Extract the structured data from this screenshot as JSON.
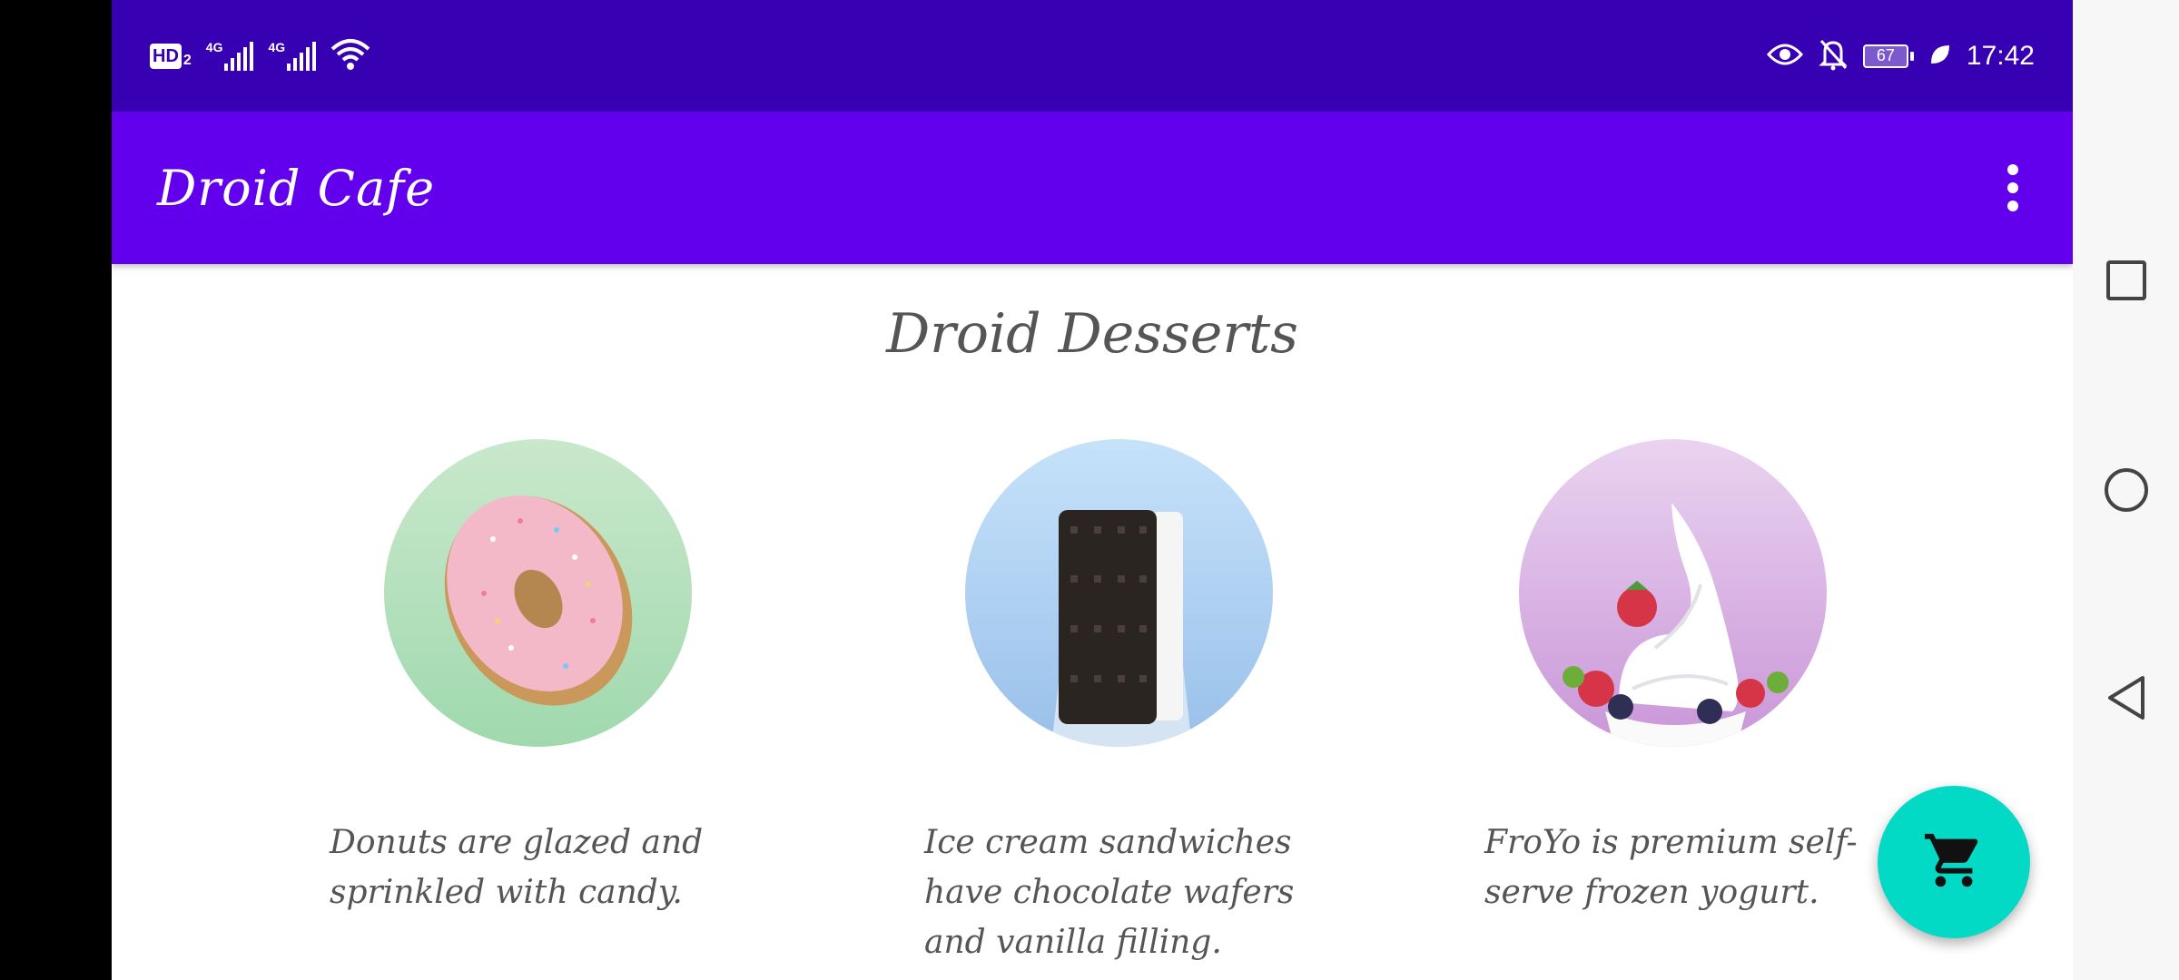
{
  "status_bar": {
    "hd_label": "HD",
    "hd_sub": "2",
    "network_1": "4G",
    "network_2": "4G",
    "battery": "67",
    "time": "17:42"
  },
  "app_bar": {
    "title": "Droid Cafe",
    "overflow_icon": "more-vert-icon"
  },
  "main": {
    "heading": "Droid Desserts",
    "desserts": [
      {
        "image": "donut-image",
        "description": "Donuts are glazed and sprinkled with candy."
      },
      {
        "image": "ice-cream-sandwich-image",
        "description": "Ice cream sandwiches have chocolate wafers and vanilla filling."
      },
      {
        "image": "froyo-image",
        "description": "FroYo is premium self-serve frozen yogurt."
      }
    ]
  },
  "fab": {
    "icon": "shopping-cart-icon"
  },
  "nav": {
    "recent_icon": "square-icon",
    "home_icon": "circle-icon",
    "back_icon": "triangle-back-icon"
  },
  "colors": {
    "status_bar": "#3700b3",
    "app_bar": "#6200ee",
    "fab": "#03dac5",
    "text": "#555555"
  }
}
